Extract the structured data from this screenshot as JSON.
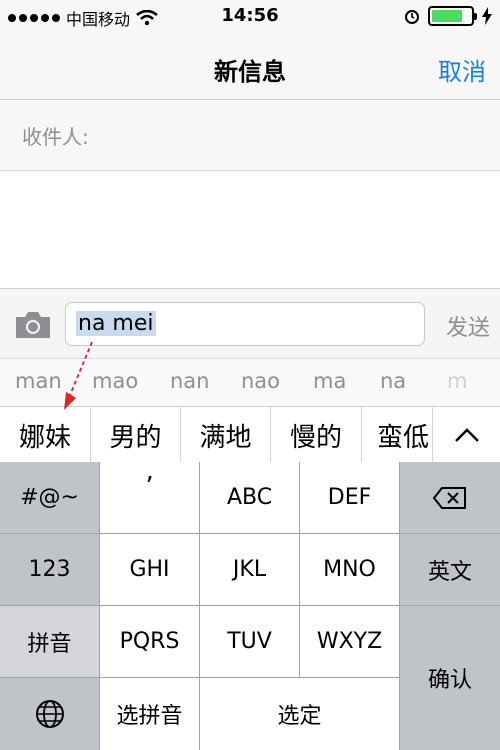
{
  "status_bar": {
    "carrier": "中国移动",
    "time": "14:56"
  },
  "nav": {
    "title": "新信息",
    "cancel": "取消"
  },
  "recipient": {
    "label": "收件人:"
  },
  "compose": {
    "input_text": "na mei",
    "send": "发送"
  },
  "pinyin_options": [
    "man",
    "mao",
    "nan",
    "nao",
    "ma",
    "na",
    "m"
  ],
  "candidates": [
    "娜妹",
    "男的",
    "满地",
    "慢的",
    "蛮低"
  ],
  "keyboard": {
    "symbols": "#@~",
    "numbers": "123",
    "pinyin": "拼音",
    "punct": "’",
    "abc": "ABC",
    "def": "DEF",
    "ghi": "GHI",
    "jkl": "JKL",
    "mno": "MNO",
    "pqrs": "PQRS",
    "tuv": "TUV",
    "wxyz": "WXYZ",
    "english": "英文",
    "confirm": "确认",
    "select_pinyin": "选拼音",
    "select": "选定"
  },
  "colors": {
    "accent": "#1e7ee0",
    "battery": "#4cd964",
    "annotation": "#d9262d"
  }
}
